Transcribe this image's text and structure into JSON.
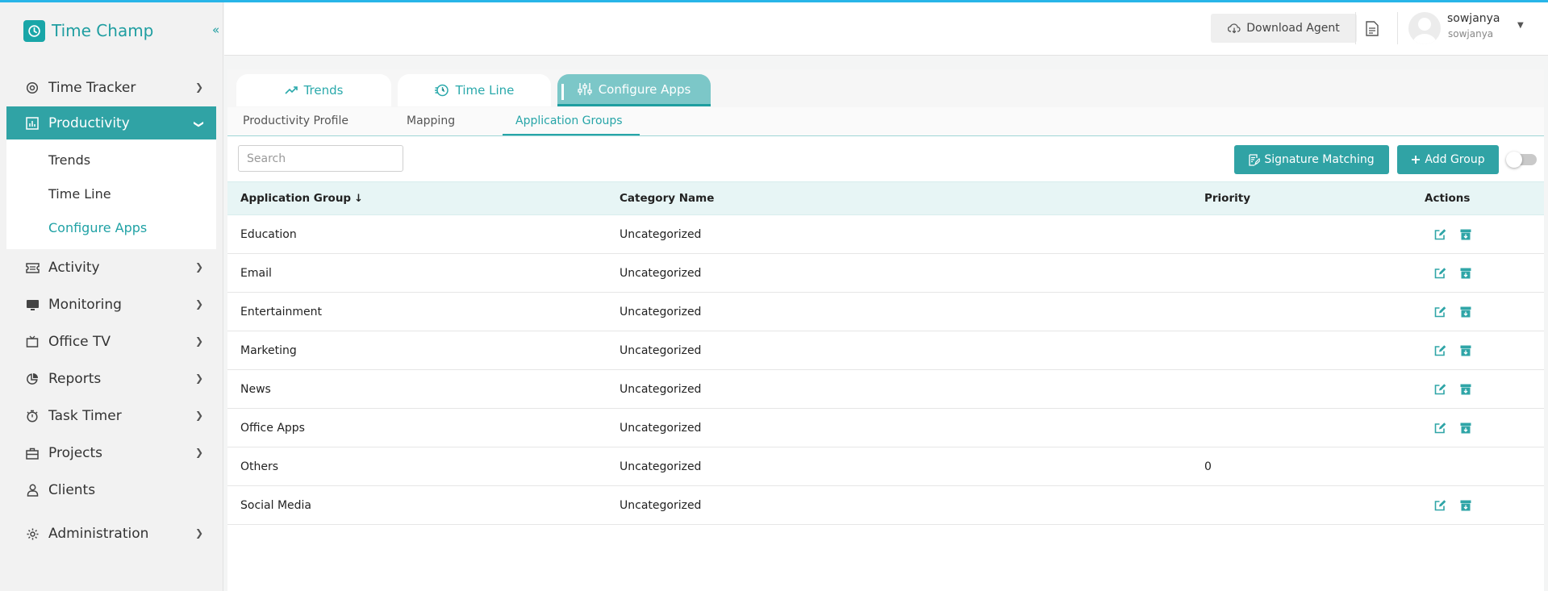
{
  "brand": {
    "name": "Time Champ",
    "accent": "#30a3a5"
  },
  "sidebar": {
    "collapse_glyph": "«",
    "items": [
      {
        "label": "Time Tracker",
        "icon": "timer-icon"
      },
      {
        "label": "Productivity",
        "icon": "bar-chart-icon",
        "active": true
      },
      {
        "label": "Activity",
        "icon": "ticket-icon"
      },
      {
        "label": "Monitoring",
        "icon": "monitor-icon"
      },
      {
        "label": "Office TV",
        "icon": "tv-icon"
      },
      {
        "label": "Reports",
        "icon": "pie-chart-icon"
      },
      {
        "label": "Task Timer",
        "icon": "stopwatch-icon"
      },
      {
        "label": "Projects",
        "icon": "briefcase-icon"
      },
      {
        "label": "Clients",
        "icon": "user-icon"
      },
      {
        "label": "Administration",
        "icon": "settings-icon"
      }
    ],
    "sub_items": [
      {
        "label": "Trends"
      },
      {
        "label": "Time Line"
      },
      {
        "label": "Configure Apps",
        "active": true
      }
    ]
  },
  "header": {
    "download_label": "Download Agent",
    "user_name": "sowjanya",
    "user_sub": "sowjanya"
  },
  "tabs": [
    {
      "label": "Trends",
      "icon": "trend-icon"
    },
    {
      "label": "Time Line",
      "icon": "timeline-icon"
    },
    {
      "label": "Configure Apps",
      "icon": "sliders-icon",
      "active": true
    }
  ],
  "subtabs": [
    {
      "label": "Productivity Profile"
    },
    {
      "label": "Mapping"
    },
    {
      "label": "Application Groups",
      "active": true
    }
  ],
  "search": {
    "placeholder": "Search",
    "value": ""
  },
  "buttons": {
    "signature": "Signature Matching",
    "add_group": "Add Group"
  },
  "toggle": {
    "on": false
  },
  "table": {
    "headers": {
      "group": "Application Group",
      "category": "Category Name",
      "priority": "Priority",
      "actions": "Actions",
      "sort_glyph": "↓"
    },
    "rows": [
      {
        "group": "Education",
        "category": "Uncategorized",
        "priority": "",
        "actions": true
      },
      {
        "group": "Email",
        "category": "Uncategorized",
        "priority": "",
        "actions": true
      },
      {
        "group": "Entertainment",
        "category": "Uncategorized",
        "priority": "",
        "actions": true
      },
      {
        "group": "Marketing",
        "category": "Uncategorized",
        "priority": "",
        "actions": true
      },
      {
        "group": "News",
        "category": "Uncategorized",
        "priority": "",
        "actions": true
      },
      {
        "group": "Office Apps",
        "category": "Uncategorized",
        "priority": "",
        "actions": true
      },
      {
        "group": "Others",
        "category": "Uncategorized",
        "priority": "0",
        "actions": false
      },
      {
        "group": "Social Media",
        "category": "Uncategorized",
        "priority": "",
        "actions": true
      }
    ]
  }
}
